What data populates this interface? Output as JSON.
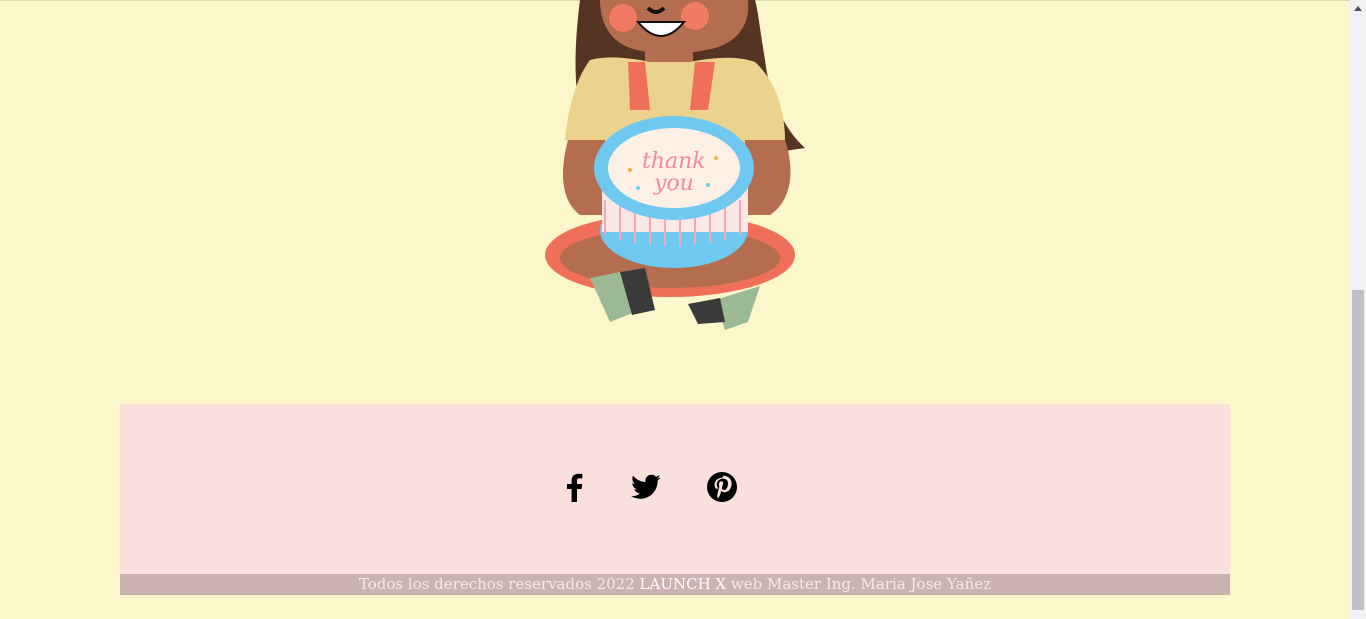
{
  "illustration": {
    "cake_text_line1": "thank",
    "cake_text_line2": "you"
  },
  "social": [
    {
      "name": "facebook",
      "icon": "facebook-icon"
    },
    {
      "name": "twitter",
      "icon": "twitter-icon"
    },
    {
      "name": "pinterest",
      "icon": "pinterest-icon"
    }
  ],
  "footer": {
    "copyright_prefix": "Todos los derechos reservados 2022",
    "brand": "LAUNCH X",
    "copyright_suffix": "web Master Ing. Maria Jose Yañez"
  },
  "colors": {
    "page_bg": "#fbf7cb",
    "footer_bg": "#fae0dc",
    "copyright_bg": "#cab3b1"
  }
}
